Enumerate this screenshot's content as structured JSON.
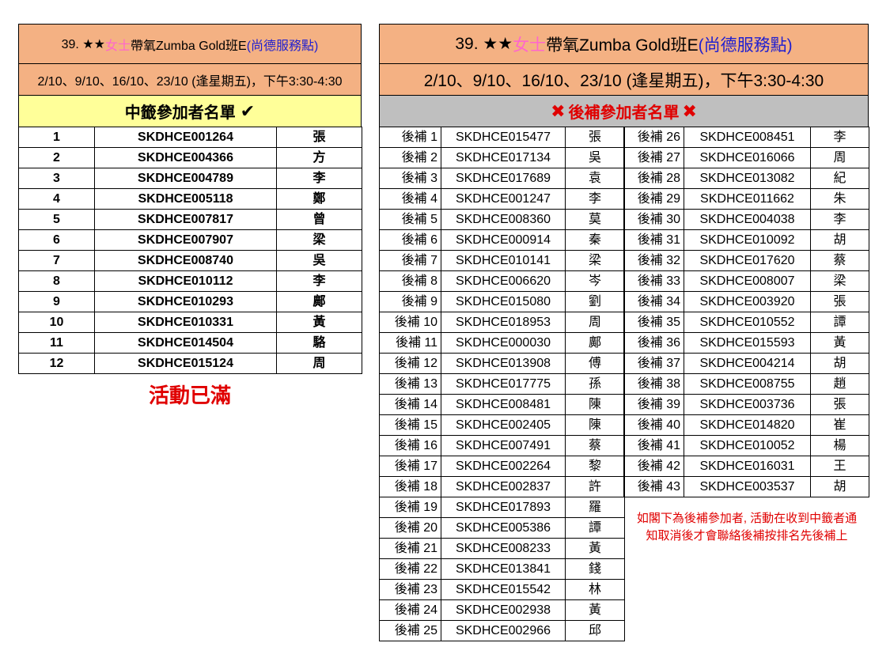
{
  "left": {
    "title": {
      "prefix": "39. ★★",
      "pink": "女士",
      "main": "帶氧Zumba Gold班E ",
      "blue": "(尚德服務點)"
    },
    "schedule": "2/10、9/10、16/10、23/10 (逢星期五)，下午3:30-4:30",
    "list_heading": "中籤參加者名單",
    "check_icon": "✔",
    "rows": [
      [
        "1",
        "SKDHCE001264",
        "張"
      ],
      [
        "2",
        "SKDHCE004366",
        "方"
      ],
      [
        "3",
        "SKDHCE004789",
        "李"
      ],
      [
        "4",
        "SKDHCE005118",
        "鄭"
      ],
      [
        "5",
        "SKDHCE007817",
        "曾"
      ],
      [
        "6",
        "SKDHCE007907",
        "梁"
      ],
      [
        "7",
        "SKDHCE008740",
        "吳"
      ],
      [
        "8",
        "SKDHCE010112",
        "李"
      ],
      [
        "9",
        "SKDHCE010293",
        "鄺"
      ],
      [
        "10",
        "SKDHCE010331",
        "黃"
      ],
      [
        "11",
        "SKDHCE014504",
        "駱"
      ],
      [
        "12",
        "SKDHCE015124",
        "周"
      ]
    ],
    "full_notice": "活動已滿"
  },
  "right": {
    "title": {
      "prefix": "39. ★★",
      "pink": "女士",
      "main": "帶氧Zumba Gold班E ",
      "blue": "(尚德服務點)"
    },
    "schedule": "2/10、9/10、16/10、23/10 (逢星期五)，下午3:30-4:30",
    "list_heading": "後補參加者名單",
    "x_icon": "✖",
    "rows_a": [
      [
        "後補 1",
        "SKDHCE015477",
        "張"
      ],
      [
        "後補 2",
        "SKDHCE017134",
        "吳"
      ],
      [
        "後補 3",
        "SKDHCE017689",
        "袁"
      ],
      [
        "後補 4",
        "SKDHCE001247",
        "李"
      ],
      [
        "後補 5",
        "SKDHCE008360",
        "莫"
      ],
      [
        "後補 6",
        "SKDHCE000914",
        "秦"
      ],
      [
        "後補 7",
        "SKDHCE010141",
        "梁"
      ],
      [
        "後補 8",
        "SKDHCE006620",
        "岑"
      ],
      [
        "後補 9",
        "SKDHCE015080",
        "劉"
      ],
      [
        "後補 10",
        "SKDHCE018953",
        "周"
      ],
      [
        "後補 11",
        "SKDHCE000030",
        "鄺"
      ],
      [
        "後補 12",
        "SKDHCE013908",
        "傅"
      ],
      [
        "後補 13",
        "SKDHCE017775",
        "孫"
      ],
      [
        "後補 14",
        "SKDHCE008481",
        "陳"
      ],
      [
        "後補 15",
        "SKDHCE002405",
        "陳"
      ],
      [
        "後補 16",
        "SKDHCE007491",
        "蔡"
      ],
      [
        "後補 17",
        "SKDHCE002264",
        "黎"
      ],
      [
        "後補 18",
        "SKDHCE002837",
        "許"
      ],
      [
        "後補 19",
        "SKDHCE017893",
        "羅"
      ],
      [
        "後補 20",
        "SKDHCE005386",
        "譚"
      ],
      [
        "後補 21",
        "SKDHCE008233",
        "黃"
      ],
      [
        "後補 22",
        "SKDHCE013841",
        "錢"
      ],
      [
        "後補 23",
        "SKDHCE015542",
        "林"
      ],
      [
        "後補 24",
        "SKDHCE002938",
        "黃"
      ],
      [
        "後補 25",
        "SKDHCE002966",
        "邱"
      ]
    ],
    "rows_b": [
      [
        "後補 26",
        "SKDHCE008451",
        "李"
      ],
      [
        "後補 27",
        "SKDHCE016066",
        "周"
      ],
      [
        "後補 28",
        "SKDHCE013082",
        "紀"
      ],
      [
        "後補 29",
        "SKDHCE011662",
        "朱"
      ],
      [
        "後補 30",
        "SKDHCE004038",
        "李"
      ],
      [
        "後補 31",
        "SKDHCE010092",
        "胡"
      ],
      [
        "後補 32",
        "SKDHCE017620",
        "蔡"
      ],
      [
        "後補 33",
        "SKDHCE008007",
        "梁"
      ],
      [
        "後補 34",
        "SKDHCE003920",
        "張"
      ],
      [
        "後補 35",
        "SKDHCE010552",
        "譚"
      ],
      [
        "後補 36",
        "SKDHCE015593",
        "黃"
      ],
      [
        "後補 37",
        "SKDHCE004214",
        "胡"
      ],
      [
        "後補 38",
        "SKDHCE008755",
        "趙"
      ],
      [
        "後補 39",
        "SKDHCE003736",
        "張"
      ],
      [
        "後補 40",
        "SKDHCE014820",
        "崔"
      ],
      [
        "後補 41",
        "SKDHCE010052",
        "楊"
      ],
      [
        "後補 42",
        "SKDHCE016031",
        "王"
      ],
      [
        "後補 43",
        "SKDHCE003537",
        "胡"
      ]
    ],
    "note_line1": "如閣下為後補參加者, 活動在收到中籤者通",
    "note_line2": "知取消後才會聯絡後補按排名先後補上"
  },
  "colors": {
    "header_bg": "#f4b183",
    "heading_yellow": "#ffff99",
    "heading_gray": "#bfbfbf",
    "accent_red": "#e00000",
    "accent_blue": "#1f1fd0",
    "accent_pink": "#ff66cc"
  }
}
